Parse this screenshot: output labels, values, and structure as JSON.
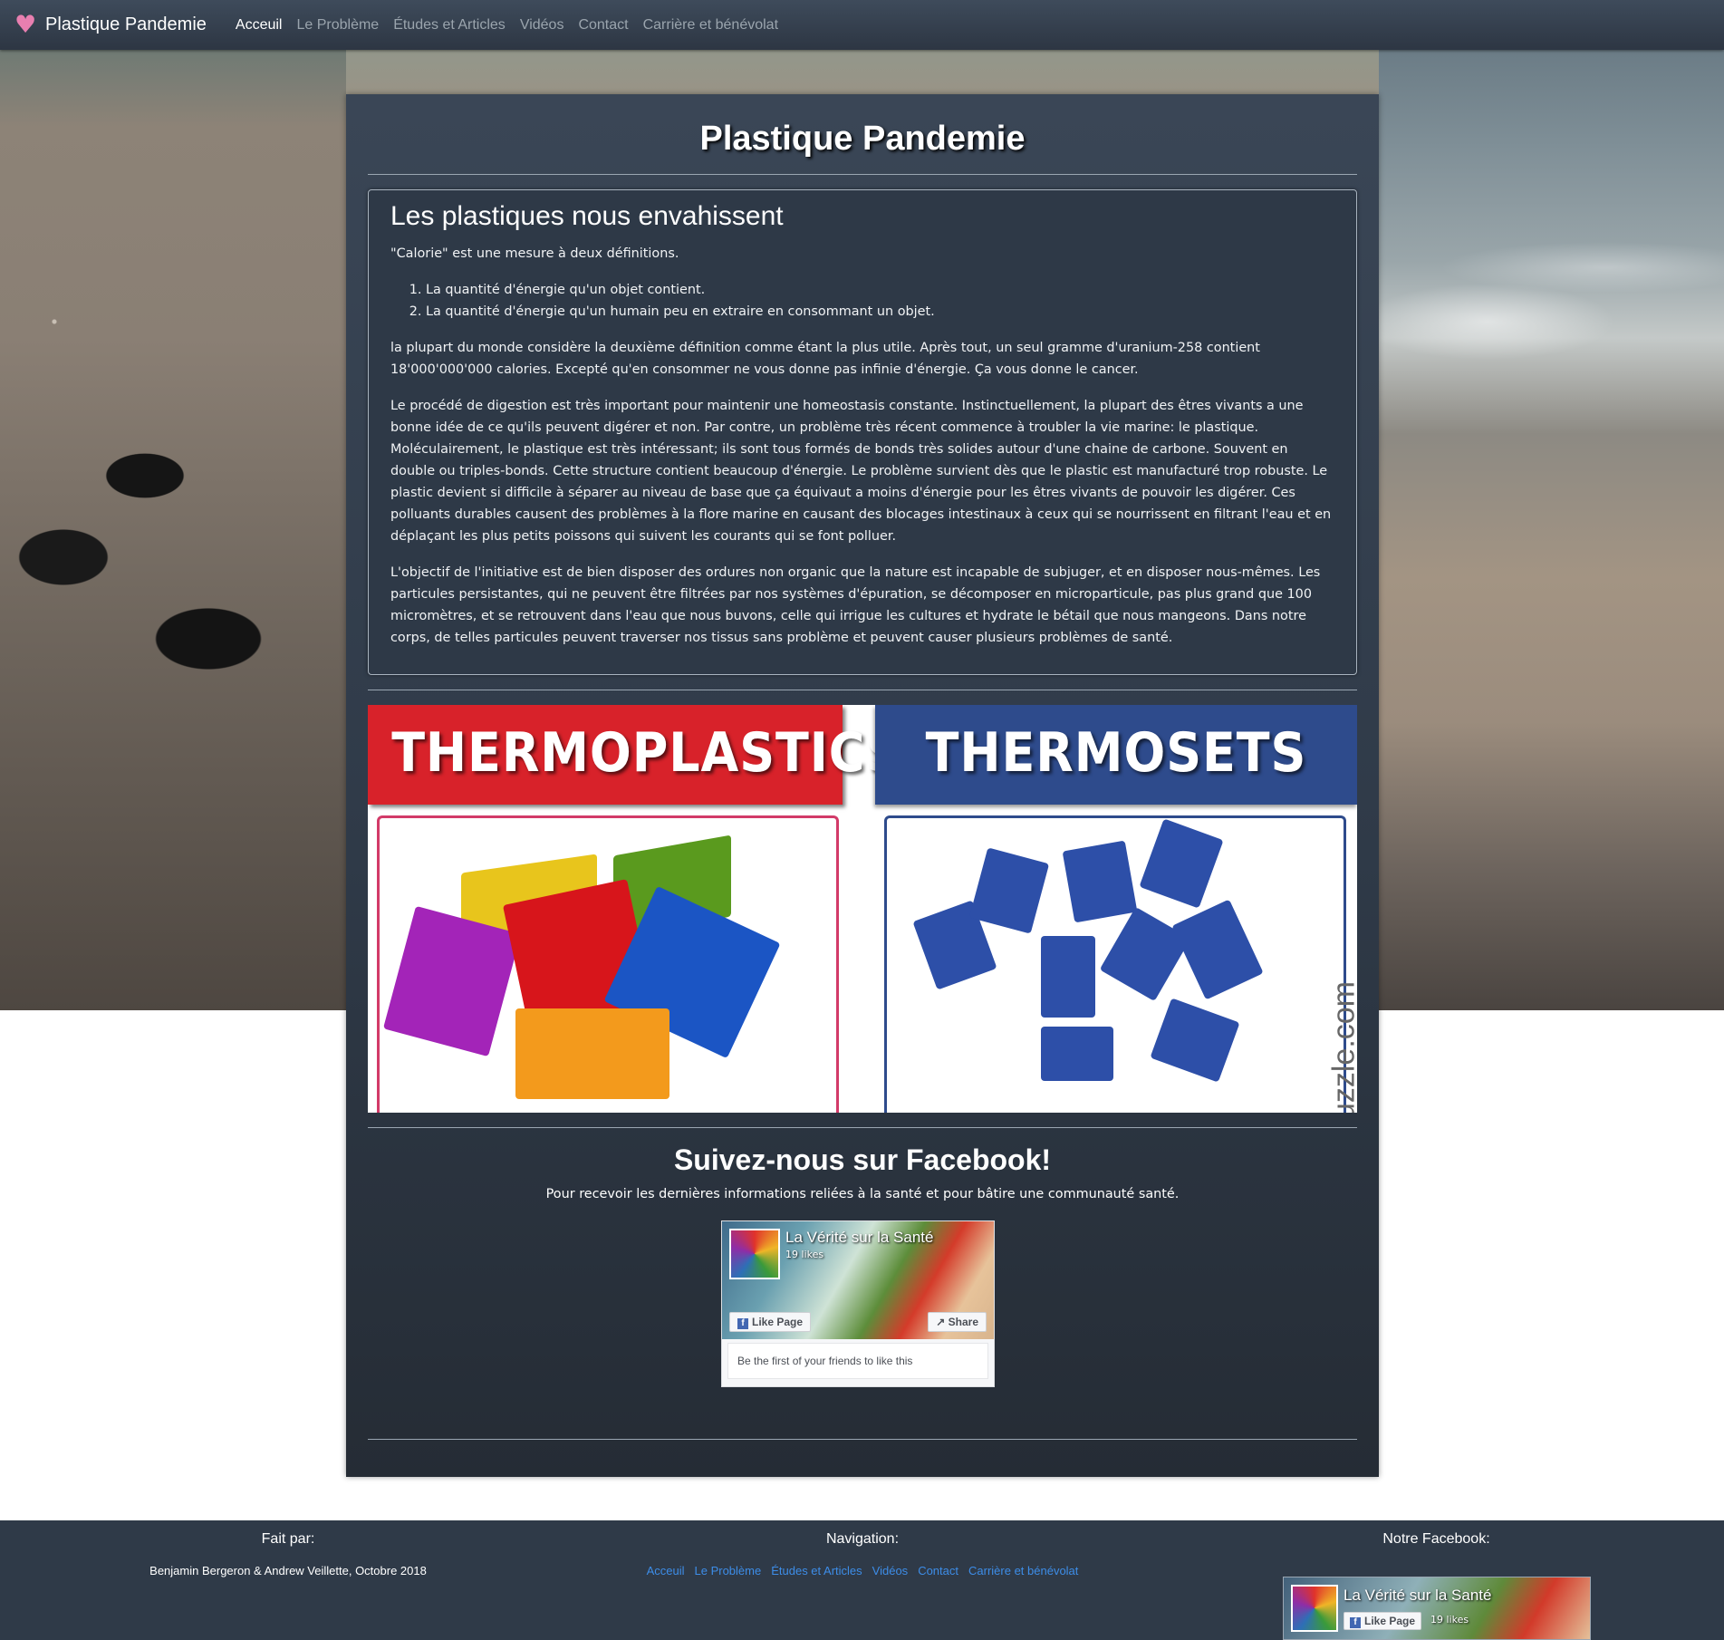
{
  "navbar": {
    "brand": "Plastique Pandemie",
    "links": [
      {
        "label": "Acceuil",
        "active": true
      },
      {
        "label": "Le Problème",
        "active": false
      },
      {
        "label": "Études et Articles",
        "active": false
      },
      {
        "label": "Vidéos",
        "active": false
      },
      {
        "label": "Contact",
        "active": false
      },
      {
        "label": "Carrière et bénévolat",
        "active": false
      }
    ]
  },
  "main": {
    "title": "Plastique Pandemie",
    "article": {
      "heading": "Les plastiques nous envahissent",
      "intro": "\"Calorie\" est une mesure à deux définitions.",
      "list": [
        "La quantité d'énergie qu'un objet contient.",
        "La quantité d'énergie qu'un humain peu en extraire en consommant un objet."
      ],
      "p1": "la plupart du monde considère la deuxième définition comme étant la plus utile. Après tout, un seul gramme d'uranium-258 contient 18'000'000'000 calories. Excepté qu'en consommer ne vous donne pas infinie d'énergie. Ça vous donne le cancer.",
      "p2": "Le procédé de digestion est très important pour maintenir une homeostasis constante. Instinctuellement, la plupart des êtres vivants a une bonne idée de ce qu'ils peuvent digérer et non. Par contre, un problème très récent commence à troubler la vie marine: le plastique. Moléculairement, le plastique est très intéressant; ils sont tous formés de bonds très solides autour d'une chaine de carbone. Souvent en double ou triples-bonds. Cette structure contient beaucoup d'énergie. Le problème survient dès que le plastic est manufacturé trop robuste. Le plastic devient si difficile à séparer au niveau de base que ça équivaut a moins d'énergie pour les êtres vivants de pouvoir les digérer. Ces polluants durables causent des problèmes à la flore marine en causant des blocages intestinaux à ceux qui se nourrissent en filtrant l'eau et en déplaçant les plus petits poissons qui suivent les courants qui se font polluer.",
      "p3": "L'objectif de l'initiative est de bien disposer des ordures non organic que la nature est incapable de subjuger, et en disposer nous-mêmes. Les particules persistantes, qui ne peuvent être filtrées par nos systèmes d'épuration, se décomposer en microparticule, pas plus grand que 100 micromètres, et se retrouvent dans l'eau que nous buvons, celle qui irrigue les cultures et hydrate le bétail que nous mangeons. Dans notre corps, de telles particules peuvent traverser nos tissus sans problème et peuvent causer plusieurs problèmes de santé."
    },
    "image": {
      "left_label": "THERMOPLASTICS",
      "right_label": "THERMOSETS",
      "watermark": "Buzzle.com"
    },
    "facebook": {
      "title": "Suivez-nous sur Facebook!",
      "subtitle": "Pour recevoir les dernières informations reliées à la santé et pour bâtire une communauté santé.",
      "page_name": "La Vérité sur la Santé",
      "likes": "19 likes",
      "like_label": "Like Page",
      "share_label": "Share",
      "friends_text": "Be the first of your friends to like this"
    }
  },
  "footer": {
    "made_heading": "Fait par:",
    "made_text": "Benjamin Bergeron & Andrew Veillette, Octobre 2018",
    "nav_heading": "Navigation:",
    "nav_links": [
      "Acceuil",
      "Le Problème",
      "Études et Articles",
      "Vidéos",
      "Contact",
      "Carrière et bénévolat"
    ],
    "fb_heading": "Notre Facebook:",
    "fb_page_name": "La Vérité sur la Santé",
    "fb_like_label": "Like Page",
    "fb_likes": "19 likes"
  },
  "colors": {
    "navbar": "#2d3643",
    "panel": "#2f3a48",
    "active_link": "#ffffff",
    "inactive_link": "#9aa4ad",
    "footer_link": "#3d8de8",
    "heart": "#e87fb0",
    "thermoplastics_red": "#d8222a",
    "thermosets_blue": "#2e4b8c"
  }
}
